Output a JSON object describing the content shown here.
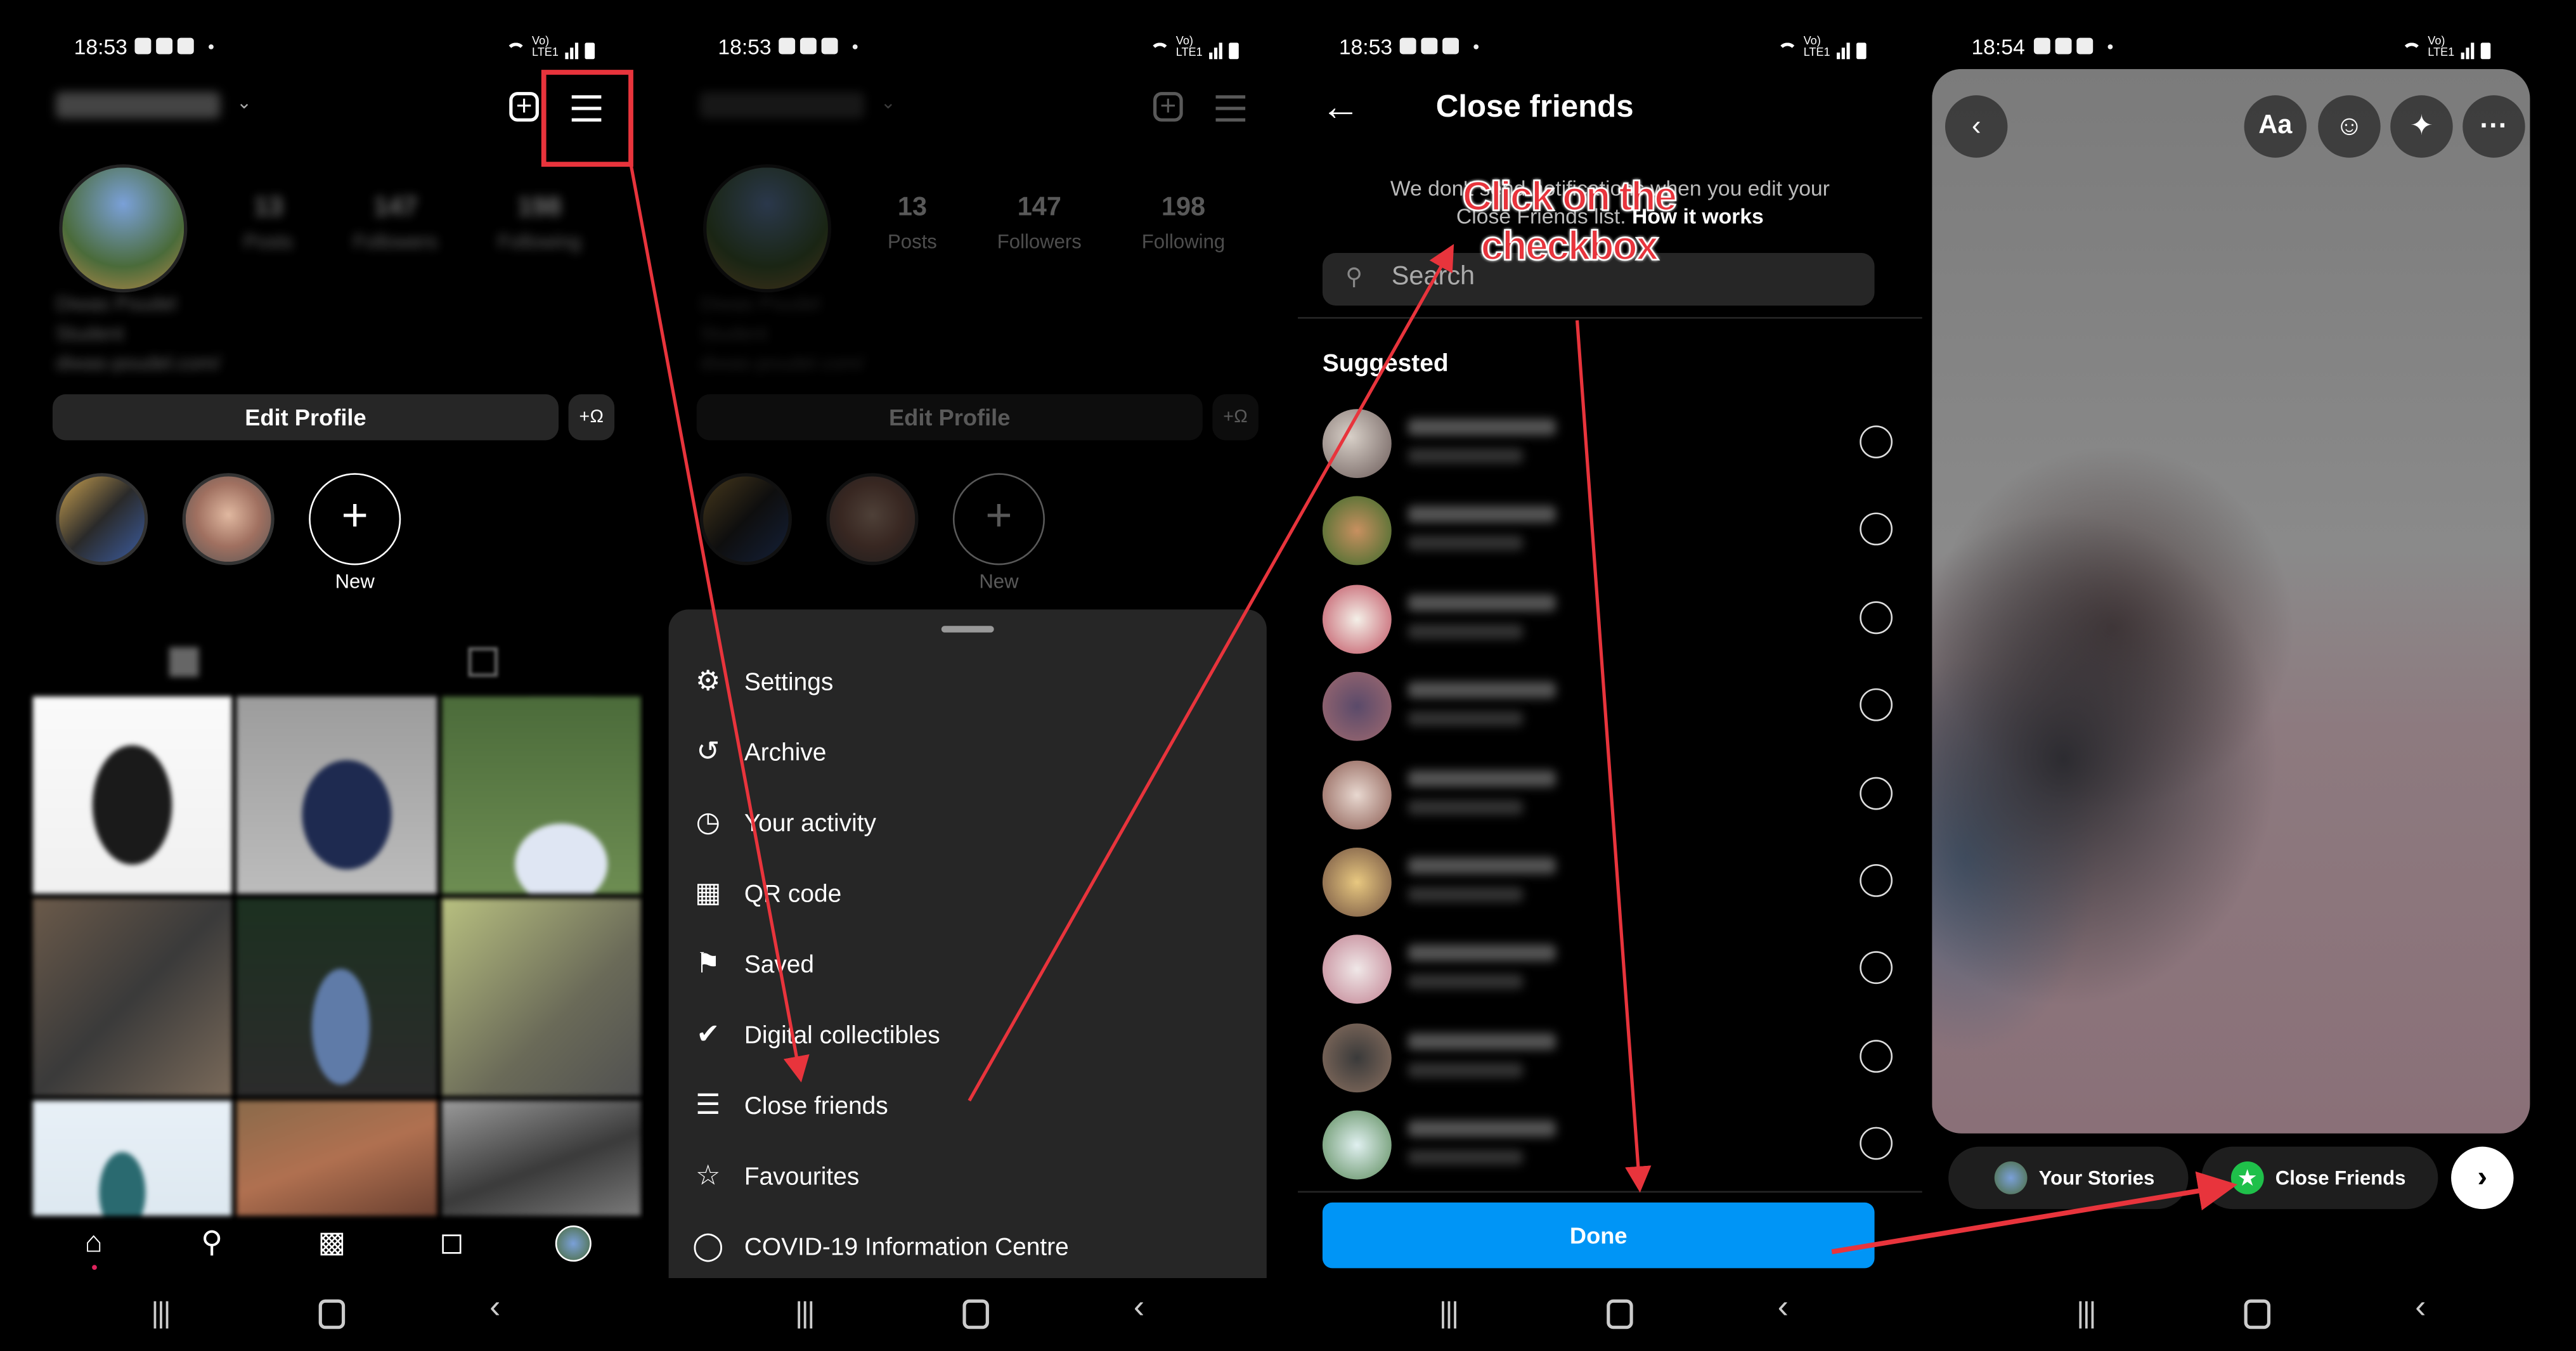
{
  "panels": {
    "profile": {
      "status_time": "18:53",
      "stats": [
        {
          "number": "13",
          "label": "Posts"
        },
        {
          "number": "147",
          "label": "Followers"
        },
        {
          "number": "198",
          "label": "Following"
        }
      ],
      "bio_lines": [
        "Diwas Poudel",
        "Student",
        "diwas-poudel.com/"
      ],
      "edit_profile_label": "Edit Profile",
      "new_highlight_label": "New",
      "highlight_plus": "+",
      "add_user_glyph": "+Ω"
    },
    "menu": {
      "status_time": "18:53",
      "items": [
        {
          "label": "Settings",
          "icon": "settings-icon"
        },
        {
          "label": "Archive",
          "icon": "archive-icon"
        },
        {
          "label": "Your activity",
          "icon": "activity-icon"
        },
        {
          "label": "QR code",
          "icon": "qr-code-icon"
        },
        {
          "label": "Saved",
          "icon": "bookmark-icon"
        },
        {
          "label": "Digital collectibles",
          "icon": "collectibles-icon"
        },
        {
          "label": "Close friends",
          "icon": "close-friends-list-icon"
        },
        {
          "label": "Favourites",
          "icon": "star-icon"
        },
        {
          "label": "COVID-19 Information Centre",
          "icon": "covid-info-icon"
        }
      ]
    },
    "close_friends": {
      "status_time": "18:53",
      "title": "Close friends",
      "note_line1": "We don't send notifications when you edit your",
      "note_line2_prefix": "Close Friends list. ",
      "note_link": "How it works",
      "search_placeholder": "Search",
      "section_label": "Suggested",
      "suggested_count": 9,
      "done_label": "Done"
    },
    "story": {
      "status_time": "18:54",
      "text_tool_label": "Aa",
      "more_label": "···",
      "your_stories_label": "Your Stories",
      "close_friends_label": "Close Friends",
      "next_glyph": "›"
    }
  },
  "annotation": {
    "callout_text_line1": "Click on the",
    "callout_text_line2": "checkbox",
    "color": "#e8343c"
  },
  "colors": {
    "done_blue": "#0095f6",
    "close_friends_green": "#1fc04a",
    "sheet_bg": "#262626"
  }
}
